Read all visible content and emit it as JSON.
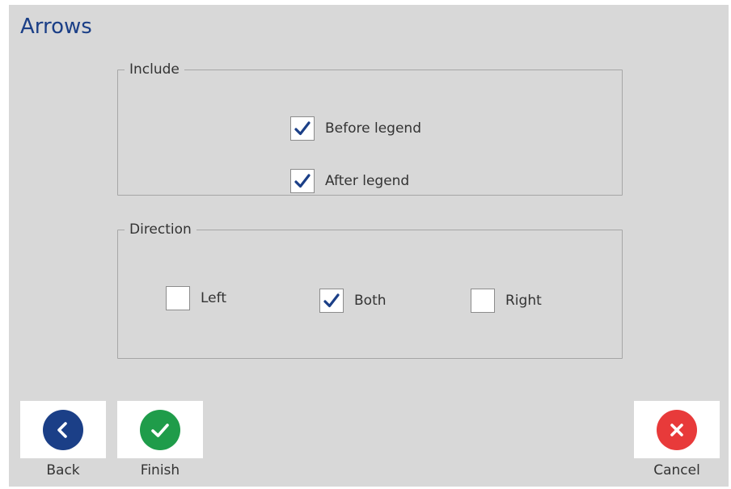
{
  "page": {
    "title": "Arrows"
  },
  "include_group": {
    "legend": "Include",
    "options": [
      {
        "label": "Before legend",
        "checked": true
      },
      {
        "label": "After legend",
        "checked": true
      }
    ]
  },
  "direction_group": {
    "legend": "Direction",
    "options": [
      {
        "label": "Left",
        "checked": false
      },
      {
        "label": "Both",
        "checked": true
      },
      {
        "label": "Right",
        "checked": false
      }
    ]
  },
  "footer": {
    "back_label": "Back",
    "finish_label": "Finish",
    "cancel_label": "Cancel"
  },
  "colors": {
    "title": "#1b3f87",
    "checkmark": "#1b3f87",
    "back": "#1b3f87",
    "finish": "#1f9c4a",
    "cancel": "#e83a3a",
    "background": "#d8d8d8"
  },
  "icons": {
    "back": "chevron-left-icon",
    "finish": "checkmark-icon",
    "cancel": "close-icon"
  }
}
